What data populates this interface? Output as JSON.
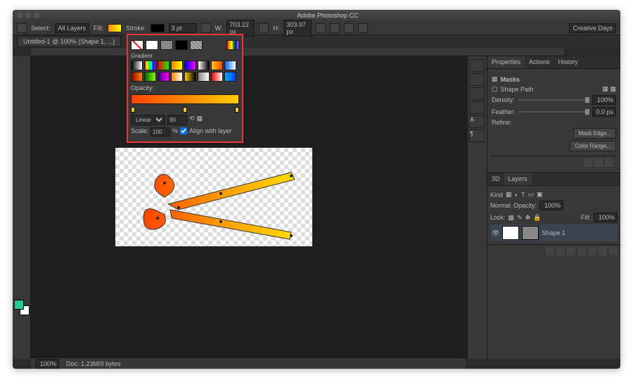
{
  "app": {
    "title": "Adobe Photoshop CC"
  },
  "options": {
    "select_label": "Select:",
    "select_value": "All Layers",
    "fill_label": "Fill:",
    "stroke_label": "Stroke:",
    "stroke_width": "3 pt",
    "w_label": "W:",
    "w_value": "703.22 px",
    "h_label": "H:",
    "h_value": "303.97 px",
    "workspace": "Creative Days"
  },
  "document": {
    "tab": "Untitled-1 @ 100% (Shape 1, ...)"
  },
  "popup": {
    "section": "Gradient",
    "opacity_label": "Opacity:",
    "type": "Linear",
    "angle": "90",
    "scale_label": "Scale:",
    "scale": "100",
    "percent": "%",
    "align": "Align with layer",
    "presets_gradients": [
      "linear-gradient(90deg,#000,#fff)",
      "linear-gradient(90deg,#f00,#ff0,#0f0,#0ff,#00f,#f0f)",
      "linear-gradient(90deg,#f00,#0f0)",
      "linear-gradient(90deg,#f80,#ff0)",
      "linear-gradient(90deg,#00f,#f0f)",
      "linear-gradient(90deg,#fff,#000)",
      "linear-gradient(90deg,#fc0,#f40)",
      "linear-gradient(90deg,#06f,#fff)",
      "linear-gradient(90deg,#800,#f80)",
      "linear-gradient(90deg,#060,#8f0)",
      "linear-gradient(90deg,#408,#f0f)",
      "linear-gradient(90deg,#f80,#fff)",
      "linear-gradient(90deg,#fc0,#000)",
      "linear-gradient(90deg,#888,#fff)",
      "linear-gradient(90deg,#f00,#fff)",
      "linear-gradient(90deg,#0af,#04f)"
    ]
  },
  "properties": {
    "tabs": [
      "Properties",
      "Actions",
      "History"
    ],
    "panel_title": "Masks",
    "path_label": "Shape Path",
    "density_label": "Density:",
    "density_value": "100%",
    "feather_label": "Feather:",
    "feather_value": "0.0 px",
    "refine_label": "Refine:",
    "mask_edge": "Mask Edge...",
    "color_range": "Color Range..."
  },
  "layers": {
    "tabs": [
      "3D",
      "Layers"
    ],
    "kind": "Kind",
    "blend": "Normal",
    "opacity_label": "Opacity:",
    "opacity": "100%",
    "lock_label": "Lock:",
    "fill_label": "Fill:",
    "fill_value": "100%",
    "layer_name": "Shape 1"
  },
  "status": {
    "zoom": "100%",
    "doc": "Doc: 1.23M/0 bytes"
  }
}
